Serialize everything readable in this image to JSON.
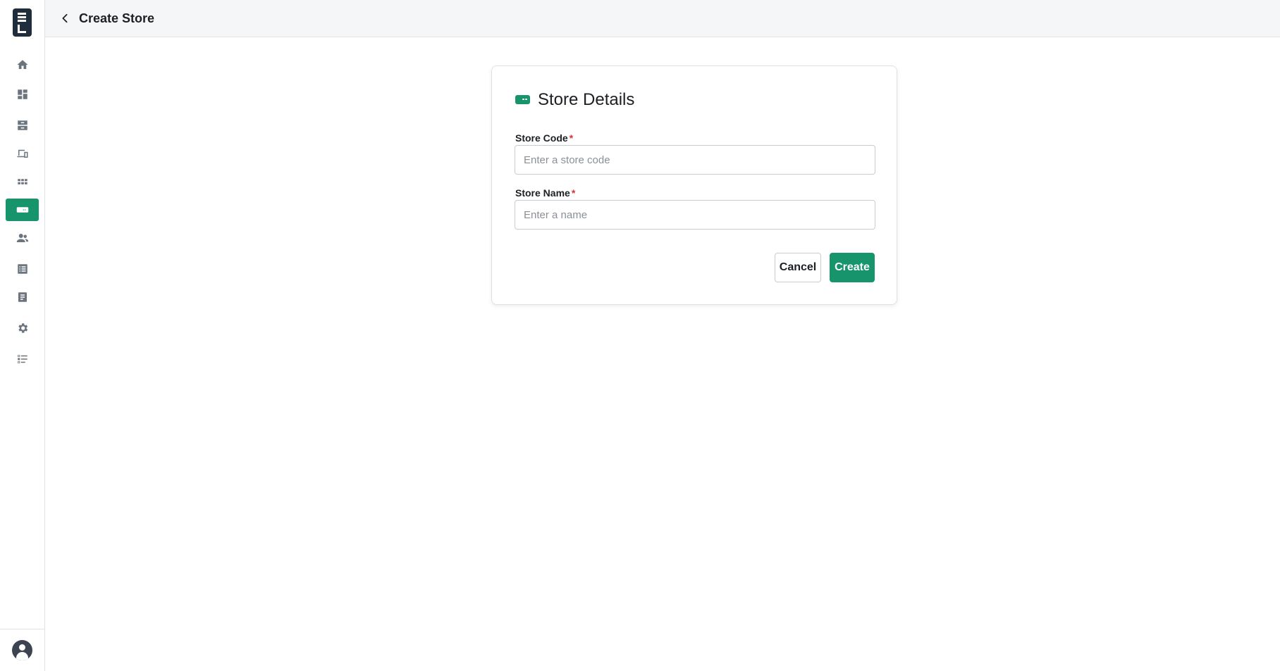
{
  "colors": {
    "accent": "#17946b",
    "required": "#d9343b",
    "sidebar_icon": "#6c757d"
  },
  "sidebar": {
    "items": [
      {
        "icon": "home-icon"
      },
      {
        "icon": "dashboard-icon"
      },
      {
        "icon": "inventory-icon"
      },
      {
        "icon": "devices-icon"
      },
      {
        "icon": "apps-icon"
      },
      {
        "icon": "store-icon",
        "active": true
      },
      {
        "icon": "users-icon"
      },
      {
        "icon": "list-icon"
      },
      {
        "icon": "document-icon"
      },
      {
        "icon": "settings-icon"
      },
      {
        "icon": "checklist-icon"
      }
    ],
    "footer_icon": "user-avatar-icon"
  },
  "header": {
    "title": "Create Store",
    "back_icon": "chevron-left-icon"
  },
  "card": {
    "title": "Store Details",
    "title_icon": "store-icon",
    "fields": [
      {
        "label": "Store Code",
        "required_mark": "*",
        "placeholder": "Enter a store code",
        "value": ""
      },
      {
        "label": "Store Name",
        "required_mark": "*",
        "placeholder": "Enter a name",
        "value": ""
      }
    ],
    "cancel_label": "Cancel",
    "create_label": "Create"
  }
}
